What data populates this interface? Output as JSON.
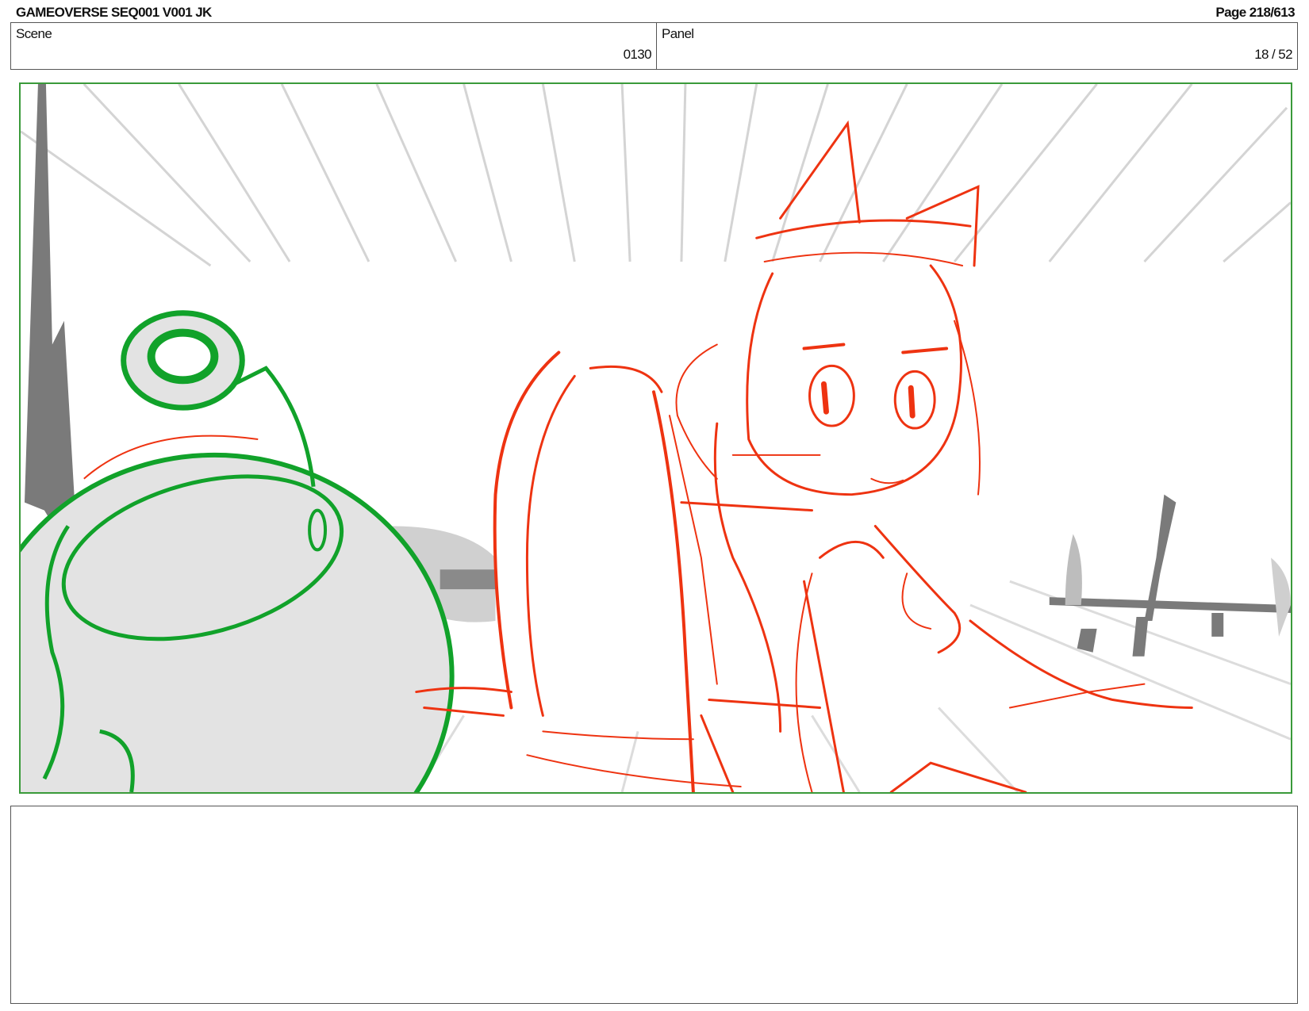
{
  "header": {
    "production_title": "GAMEOVERSE SEQ001 V001 JK",
    "page_label": "Page 218/613"
  },
  "info": {
    "scene_label": "Scene",
    "scene_value": "0130",
    "panel_label": "Panel",
    "panel_value": "18 / 52"
  },
  "colors": {
    "frame_border": "#3a9a3a",
    "sketch_red": "#ee3311",
    "sketch_green": "#11a22a",
    "sketch_gray": "#7a7a7a",
    "fill_gray": "#e3e3e3"
  },
  "notes": {
    "text": ""
  }
}
